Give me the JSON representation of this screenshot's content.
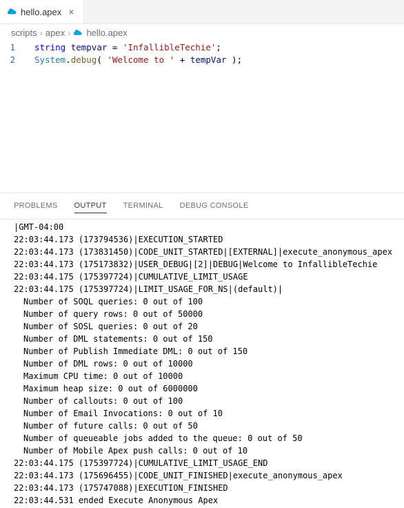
{
  "tab": {
    "label": "hello.apex",
    "icon": "cloud-icon"
  },
  "breadcrumb": {
    "parts": [
      "scripts",
      "apex",
      "hello.apex"
    ]
  },
  "code": {
    "lines": [
      {
        "num": "1",
        "tokens": [
          {
            "t": "string",
            "c": "tok-kw"
          },
          {
            "t": " ",
            "c": ""
          },
          {
            "t": "tempvar",
            "c": "tok-var"
          },
          {
            "t": " = ",
            "c": "tok-punct"
          },
          {
            "t": "'InfallibleTechie'",
            "c": "tok-str"
          },
          {
            "t": ";",
            "c": "tok-punct"
          }
        ]
      },
      {
        "num": "2",
        "tokens": [
          {
            "t": "System",
            "c": "tok-cls"
          },
          {
            "t": ".",
            "c": "tok-punct"
          },
          {
            "t": "debug",
            "c": "tok-fn"
          },
          {
            "t": "( ",
            "c": "tok-punct"
          },
          {
            "t": "'Welcome to '",
            "c": "tok-str"
          },
          {
            "t": " + ",
            "c": "tok-punct"
          },
          {
            "t": "tempVar",
            "c": "tok-var"
          },
          {
            "t": " )",
            "c": "tok-punct"
          },
          {
            "t": ";",
            "c": "tok-punct"
          }
        ]
      }
    ]
  },
  "panel": {
    "tabs": {
      "problems": "PROBLEMS",
      "output": "OUTPUT",
      "terminal": "TERMINAL",
      "debug_console": "DEBUG CONSOLE"
    }
  },
  "output": {
    "lines": [
      "|GMT-04:00",
      "22:03:44.173 (173794536)|EXECUTION_STARTED",
      "22:03:44.173 (173831450)|CODE_UNIT_STARTED|[EXTERNAL]|execute_anonymous_apex",
      "22:03:44.173 (175173832)|USER_DEBUG|[2]|DEBUG|Welcome to InfallibleTechie",
      "22:03:44.175 (175397724)|CUMULATIVE_LIMIT_USAGE",
      "22:03:44.175 (175397724)|LIMIT_USAGE_FOR_NS|(default)|"
    ],
    "limits": [
      "Number of SOQL queries: 0 out of 100",
      "Number of query rows: 0 out of 50000",
      "Number of SOSL queries: 0 out of 20",
      "Number of DML statements: 0 out of 150",
      "Number of Publish Immediate DML: 0 out of 150",
      "Number of DML rows: 0 out of 10000",
      "Maximum CPU time: 0 out of 10000",
      "Maximum heap size: 0 out of 6000000",
      "Number of callouts: 0 out of 100",
      "Number of Email Invocations: 0 out of 10",
      "Number of future calls: 0 out of 50",
      "Number of queueable jobs added to the queue: 0 out of 50",
      "Number of Mobile Apex push calls: 0 out of 10"
    ],
    "lines2": [
      "22:03:44.175 (175397724)|CUMULATIVE_LIMIT_USAGE_END",
      "",
      "22:03:44.173 (175696455)|CODE_UNIT_FINISHED|execute_anonymous_apex",
      "22:03:44.173 (175747088)|EXECUTION_FINISHED",
      "",
      "22:03:44.531 ended Execute Anonymous Apex"
    ]
  }
}
